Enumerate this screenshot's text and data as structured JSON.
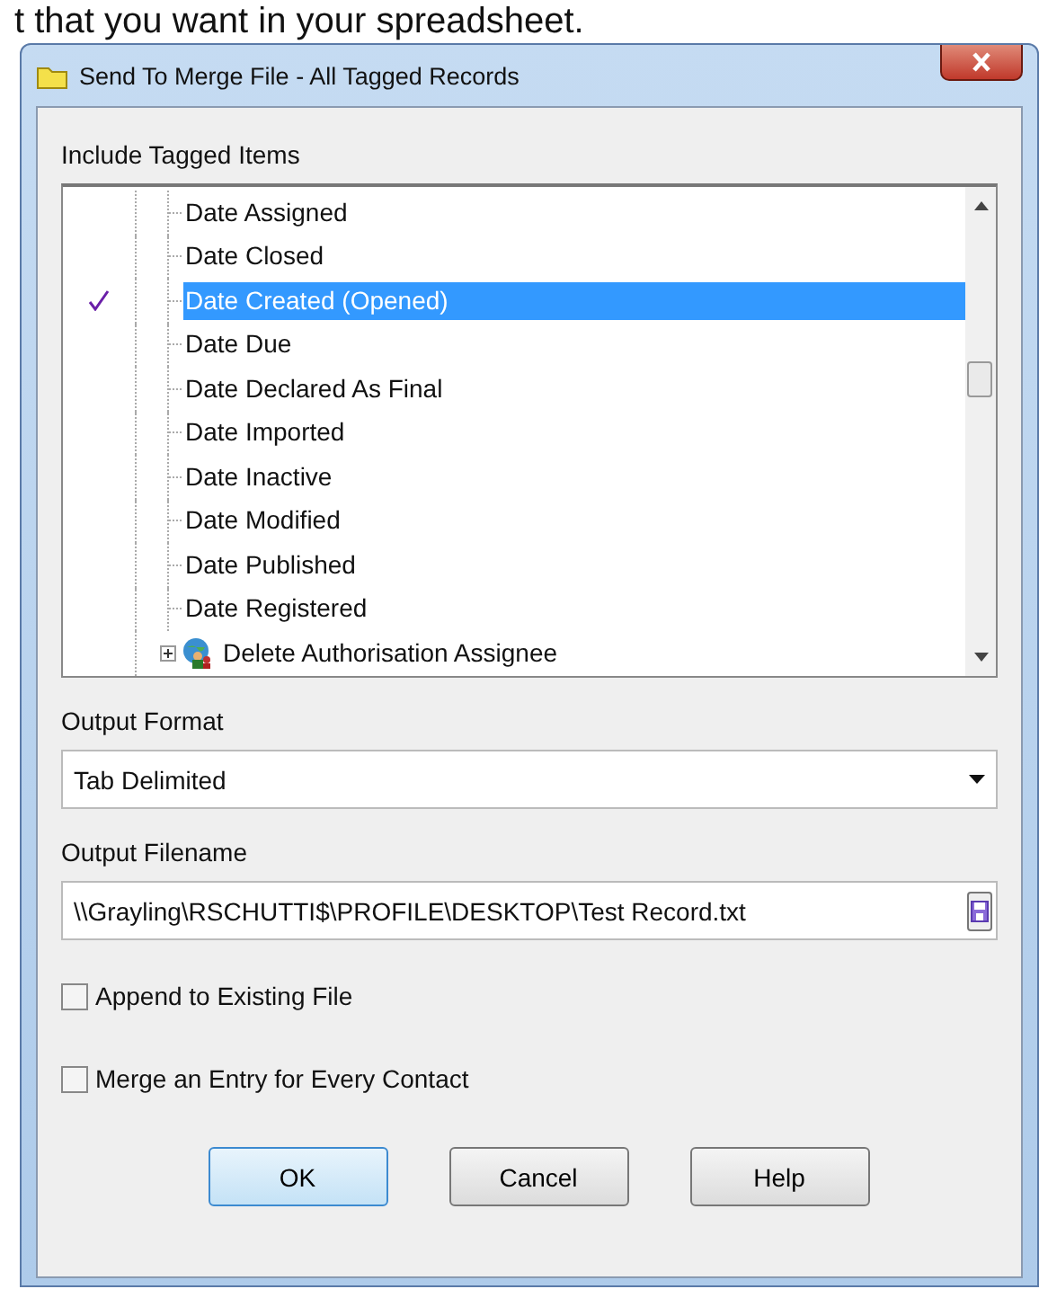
{
  "caption": "t that you want in your spreadsheet.",
  "window": {
    "title": "Send To Merge File - All Tagged Records"
  },
  "tagged_items": {
    "label": "Include Tagged Items",
    "items": [
      {
        "kind": "leaf",
        "label": "Date Assigned",
        "checked": false,
        "selected": false
      },
      {
        "kind": "leaf",
        "label": "Date Closed",
        "checked": false,
        "selected": false
      },
      {
        "kind": "leaf",
        "label": "Date Created (Opened)",
        "checked": true,
        "selected": true
      },
      {
        "kind": "leaf",
        "label": "Date Due",
        "checked": false,
        "selected": false
      },
      {
        "kind": "leaf",
        "label": "Date Declared As Final",
        "checked": false,
        "selected": false
      },
      {
        "kind": "leaf",
        "label": "Date Imported",
        "checked": false,
        "selected": false
      },
      {
        "kind": "leaf",
        "label": "Date Inactive",
        "checked": false,
        "selected": false
      },
      {
        "kind": "leaf",
        "label": "Date Modified",
        "checked": false,
        "selected": false
      },
      {
        "kind": "leaf",
        "label": "Date Published",
        "checked": false,
        "selected": false
      },
      {
        "kind": "leaf",
        "label": "Date Registered",
        "checked": false,
        "selected": false
      },
      {
        "kind": "group",
        "label": "Delete Authorisation Assignee",
        "checked": false,
        "selected": false,
        "expanded": false
      }
    ]
  },
  "output_format": {
    "label": "Output Format",
    "value": "Tab Delimited"
  },
  "output_filename": {
    "label": "Output Filename",
    "value": "\\\\Grayling\\RSCHUTTI$\\PROFILE\\DESKTOP\\Test Record.txt"
  },
  "options": [
    {
      "label": "Append to Existing File",
      "checked": false
    },
    {
      "label": "Merge an Entry for Every Contact",
      "checked": false
    }
  ],
  "buttons": [
    "OK",
    "Cancel",
    "Help"
  ]
}
